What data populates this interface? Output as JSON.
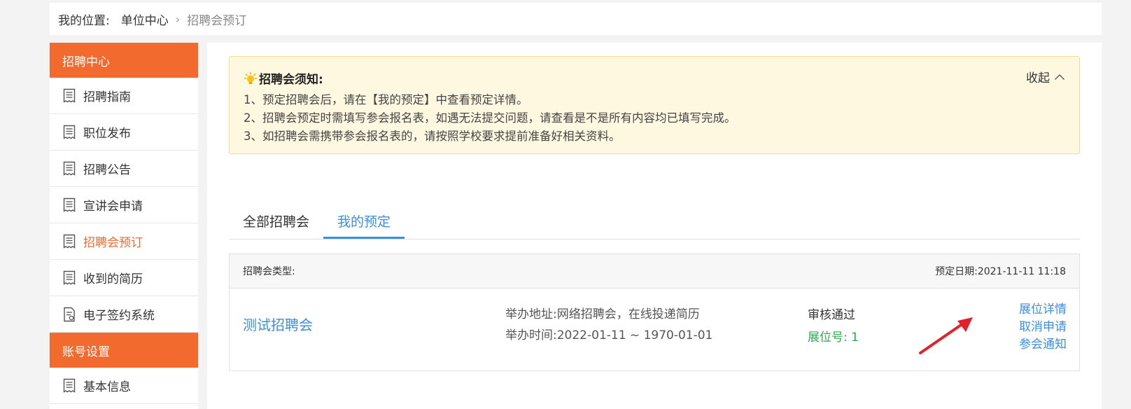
{
  "breadcrumb": {
    "label": "我的位置:",
    "home": "单位中心",
    "separator": "›",
    "current": "招聘会预订"
  },
  "sidebar": {
    "section1_title": "招聘中心",
    "items": [
      {
        "label": "招聘指南",
        "icon": "document-icon"
      },
      {
        "label": "职位发布",
        "icon": "document-icon"
      },
      {
        "label": "招聘公告",
        "icon": "document-icon"
      },
      {
        "label": "宣讲会申请",
        "icon": "document-icon"
      },
      {
        "label": "招聘会预订",
        "icon": "document-icon",
        "active": true
      },
      {
        "label": "收到的简历",
        "icon": "document-icon"
      },
      {
        "label": "电子签约系统",
        "icon": "file-sign-icon"
      }
    ],
    "section2_title": "账号设置",
    "items2": [
      {
        "label": "基本信息",
        "icon": "document-icon"
      }
    ]
  },
  "notice": {
    "title": "招聘会须知:",
    "collapse_label": "收起",
    "lines": [
      "1、预定招聘会后，请在【我的预定】中查看预定详情。",
      "2、招聘会预定时需填写参会报名表，如遇无法提交问题，请查看是不是所有内容均已填写完成。",
      "3、如招聘会需携带参会报名表的，请按照学校要求提前准备好相关资料。"
    ]
  },
  "tabs": [
    {
      "label": "全部招聘会"
    },
    {
      "label": "我的预定",
      "active": true
    }
  ],
  "booking": {
    "type_label": "招聘会类型:",
    "date_label": "预定日期:",
    "date_value": "2021-11-11 11:18",
    "name": "测试招聘会",
    "address_label": "举办地址:",
    "address_value": "网络招聘会，在线投递简历",
    "time_label": "举办时间:",
    "time_value": "2022-01-11 ~ 1970-01-01",
    "status": "审核通过",
    "booth_label": "展位号:",
    "booth_value": "1",
    "actions": [
      "展位详情",
      "取消申请",
      "参会通知"
    ]
  },
  "colors": {
    "accent_orange": "#f26a2d",
    "link_blue": "#3a8ee6",
    "success_green": "#2fa84f",
    "notice_bg": "#fef8e1",
    "annotation_red": "#e0222a"
  }
}
